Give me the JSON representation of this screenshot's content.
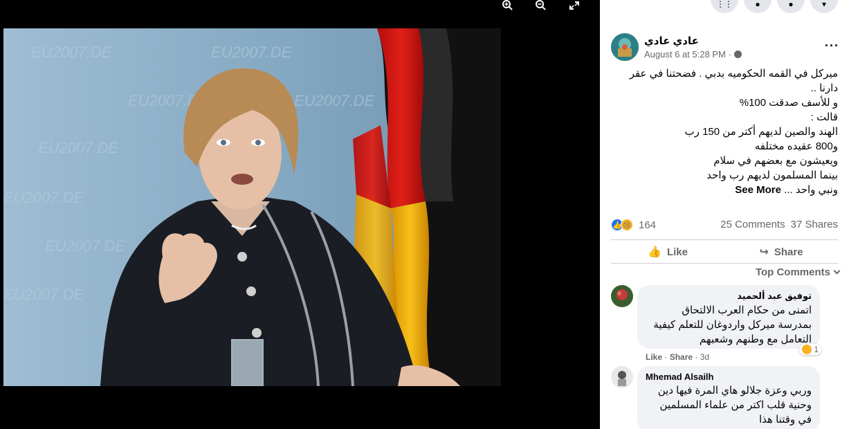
{
  "viewer": {
    "tools": [
      "zoom-in",
      "zoom-out",
      "fullscreen"
    ],
    "photo_backdrop_text": "EU2007.DE"
  },
  "panel": {
    "top_buttons": [
      "menu-grid",
      "messenger",
      "notifications",
      "account"
    ]
  },
  "post": {
    "author": "عادي عادي",
    "timestamp": "August 6 at 5:28 PM",
    "separator": "·",
    "text_lines": [
      "ميركل في القمه الحكوميه بدبي . فضحتنا في عقر",
      "دارنا ..",
      "و للأسف صدقت 100%",
      "قالت :",
      "الهند والصين لديهم أكتر من 150 رب",
      "و800 عقيده مختلفه",
      "ويعيشون مع بعضهم في سلام",
      "بينما المسلمون لديهم رب واحد",
      "ونبي واحد ..."
    ],
    "see_more": "See More",
    "reaction_count": "164",
    "comments_count": "25 Comments",
    "shares_count": "37 Shares",
    "like_label": "Like",
    "share_label": "Share",
    "top_comments_label": "Top Comments"
  },
  "comments": [
    {
      "name": "توفيق عبد ألحميد",
      "text_lines": [
        "اتمنى من حكام العرب الالتحاق",
        "بمدرسة ميركل واردوغان للتعلم كيفية",
        "التعامل مع وطنهم وشعبهم"
      ],
      "reaction_count": "1",
      "like": "Like",
      "share": "Share",
      "dot": "·",
      "age": "3d"
    },
    {
      "name": "Mhemad Alsailh",
      "text_lines": [
        "وربي وعزة جلالو هاي المرة فيها دين",
        "وحنية قلب اكتر من علماء المسلمين",
        "في وقتنا هذا"
      ]
    }
  ],
  "colors": {
    "panel_bg": "#ffffff",
    "meta_text": "#65676b",
    "bubble_bg": "#f0f2f5",
    "like_blue": "#1877f2",
    "sad_yellow": "#f7b125"
  }
}
